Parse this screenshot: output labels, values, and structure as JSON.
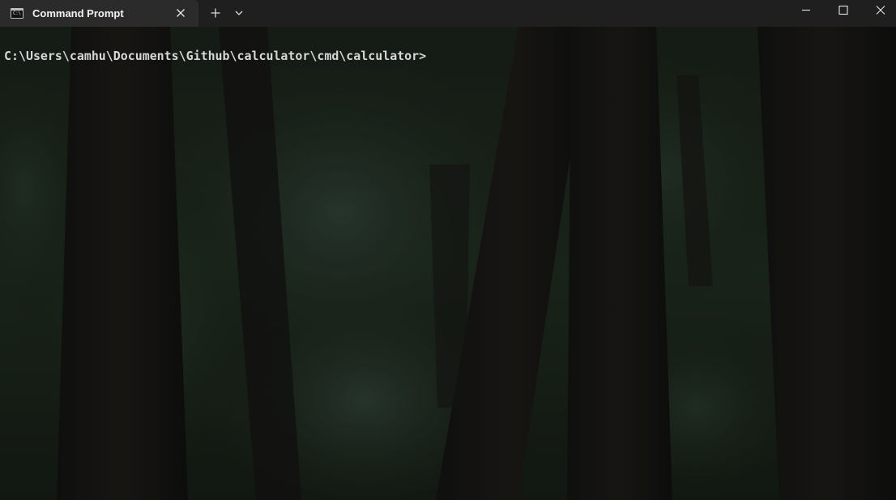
{
  "tab": {
    "title": "Command Prompt",
    "icon": "cmd-icon",
    "icon_text": "C:\\"
  },
  "terminal": {
    "prompt": "C:\\Users\\camhu\\Documents\\Github\\calculator\\cmd\\calculator>"
  },
  "colors": {
    "titlebar": "#1f1f1f",
    "active_tab": "#2b2b2b",
    "terminal_text": "#d7d7d7"
  }
}
